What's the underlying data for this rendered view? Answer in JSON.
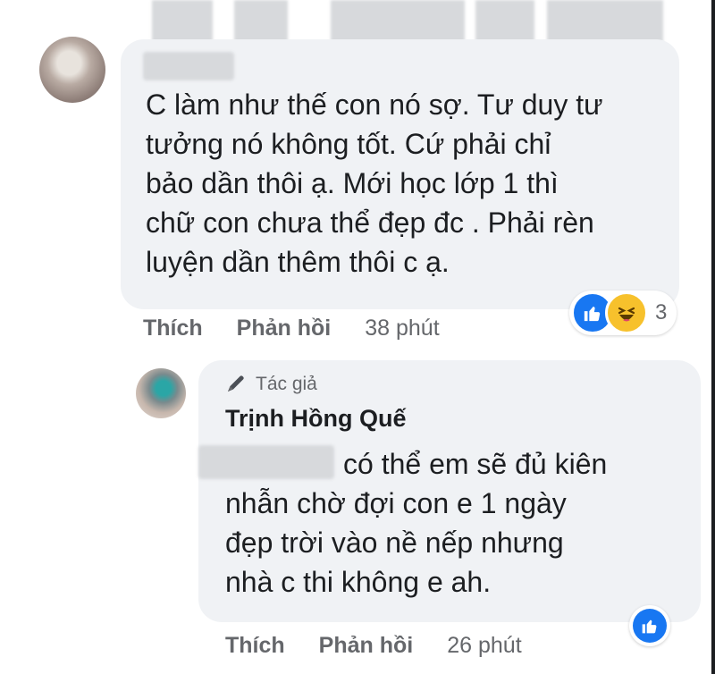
{
  "comment1": {
    "text": "C làm như thế con nó sợ. Tư duy tư\ntưởng nó không tốt. Cứ phải chỉ\nbảo dần thôi ạ. Mới học lớp 1 thì\nchữ con chưa thể đẹp đc . Phải rèn\nluyện dần thêm thôi c ạ.",
    "like_label": "Thích",
    "reply_label": "Phản hồi",
    "time": "38 phút",
    "reaction_count": "3",
    "reaction_icons": [
      "like-icon",
      "haha-icon"
    ]
  },
  "reply": {
    "author_badge": "Tác giả",
    "author_badge_icon": "pencil-icon",
    "author_name": "Trịnh Hồng Quế",
    "text_first": "có thể em sẽ đủ kiên",
    "text_rest": "nhẫn chờ đợi con e 1 ngày\nđẹp trời vào nề nếp nhưng\nnhà c thi không e ah.",
    "like_label": "Thích",
    "reply_label": "Phản hồi",
    "time": "26 phút",
    "reaction_icons": [
      "like-icon"
    ]
  },
  "colors": {
    "bubble": "#f0f2f5",
    "text": "#1c1e21",
    "meta": "#65676b",
    "like_blue": "#1877f2",
    "haha_yellow": "#f7c12c"
  }
}
